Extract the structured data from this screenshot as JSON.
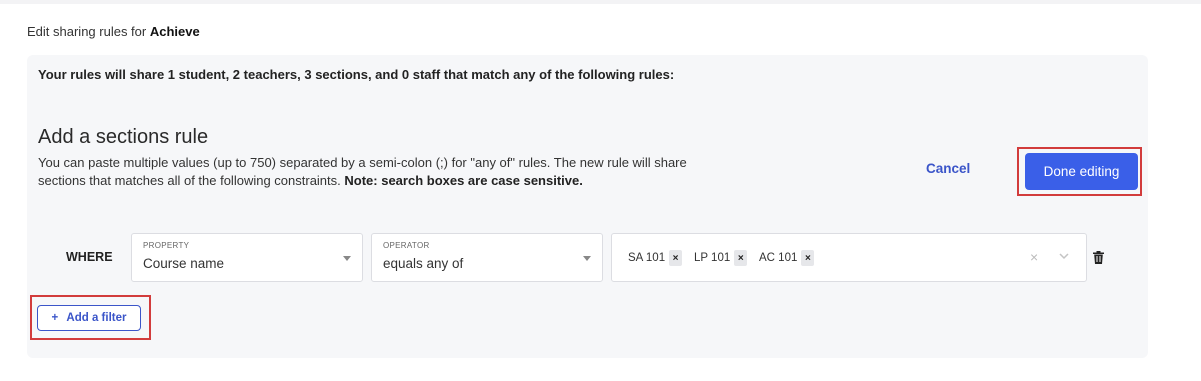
{
  "header": {
    "prefix": "Edit sharing rules for",
    "app_name": "Achieve"
  },
  "summary": "Your rules will share 1 student, 2 teachers, 3 sections, and 0 staff that match any of the following rules:",
  "rule": {
    "title": "Add a sections rule",
    "description_plain": "You can paste multiple values (up to 750) separated by a semi-colon (;) for \"any of\" rules. The new rule will share sections that matches all of the following constraints.",
    "description_note": "Note: search boxes are case sensitive."
  },
  "actions": {
    "cancel_label": "Cancel",
    "done_label": "Done editing"
  },
  "filter": {
    "where_label": "WHERE",
    "property": {
      "label": "PROPERTY",
      "value": "Course name"
    },
    "operator": {
      "label": "OPERATOR",
      "value": "equals any of"
    },
    "tags": [
      {
        "label": "SA 101",
        "remove": "×"
      },
      {
        "label": "LP 101",
        "remove": "×"
      },
      {
        "label": "AC 101",
        "remove": "×"
      }
    ],
    "clear_symbol": "×"
  },
  "add_filter_label": "Add a filter",
  "add_filter_plus": "+",
  "colors": {
    "primary": "#3a5fe8",
    "link": "#3b55c9",
    "highlight": "#d23c3c",
    "panel_bg": "#f6f7f9"
  },
  "icons": [
    "chevron-down-icon",
    "trash-icon",
    "close-icon",
    "plus-icon"
  ]
}
